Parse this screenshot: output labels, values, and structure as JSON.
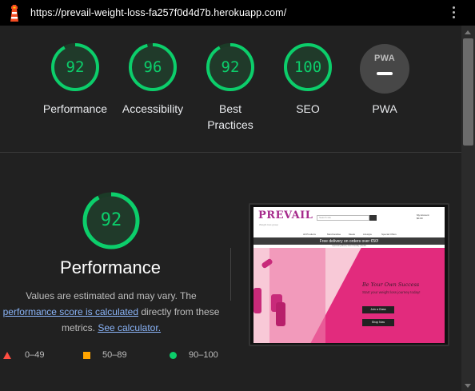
{
  "topbar": {
    "url": "https://prevail-weight-loss-fa257f0d4d7b.herokuapp.com/",
    "logo_icon": "lighthouse-icon",
    "menu_icon": "kebab-menu-icon"
  },
  "colors": {
    "pass": "#0cce6b",
    "average": "#ffa400",
    "fail": "#ff4e42",
    "background": "#212121",
    "link": "#8ab4f8"
  },
  "gauges": [
    {
      "label": "Performance",
      "score": "92",
      "value": 92
    },
    {
      "label": "Accessibility",
      "score": "96",
      "value": 96
    },
    {
      "label": "Best Practices",
      "score": "92",
      "value": 92
    },
    {
      "label": "SEO",
      "score": "100",
      "value": 100
    }
  ],
  "pwa": {
    "label": "PWA",
    "badge_text": "PWA"
  },
  "performance": {
    "score": "92",
    "value": 92,
    "title": "Performance",
    "desc_before": "Values are estimated and may vary. The ",
    "link1": "performance score is calculated",
    "desc_middle": " directly from these metrics. ",
    "link2": "See calculator."
  },
  "legend": [
    {
      "icon": "triangle-icon",
      "range": "0–49"
    },
    {
      "icon": "square-icon",
      "range": "50–89"
    },
    {
      "icon": "circle-icon",
      "range": "90–100"
    }
  ],
  "screenshot": {
    "logo": "PREVAIL",
    "tagline": "Weight loss group",
    "search_placeholder": "Search site",
    "icons": [
      "My Account",
      "$0.00"
    ],
    "nav": [
      "All Products",
      "Merchandise",
      "Meals",
      "Lifestyle",
      "Special Offers"
    ],
    "banner": "Free delivery on orders over €50!",
    "subbanner": "Upcoming Meal | Give Friendly | Deals",
    "hero_title": "Be Your Own Success",
    "hero_sub": "Start your weight loss journey today!",
    "btn_join": "Join a Class",
    "btn_shop": "Shop Now"
  }
}
